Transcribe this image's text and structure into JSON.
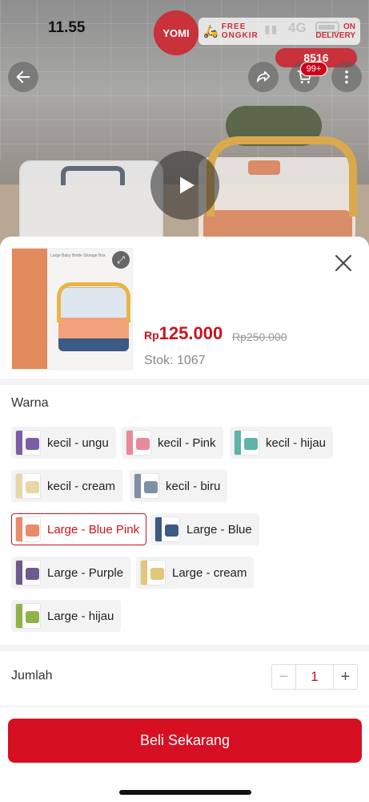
{
  "status_bar": {
    "time": "11.55",
    "network": "4G"
  },
  "header": {
    "brand_logo": "YOMI",
    "promo": {
      "line1": "FREE",
      "line2": "ONGKIR",
      "line3": "ON",
      "line4": "DELIVERY"
    },
    "promo_code": "8516",
    "cart_badge": "99+",
    "icons": {
      "back": "arrow-left-icon",
      "share": "share-icon",
      "cart": "cart-icon",
      "more": "more-vertical-icon",
      "play": "play-icon"
    }
  },
  "sheet": {
    "product": {
      "thumbnail_title": "Large Baby Bottle Storage Box",
      "price_currency": "Rp",
      "price": "125.000",
      "original_price": "Rp250.000",
      "stock_label": "Stok:",
      "stock_value": "1067"
    },
    "variant_label": "Warna",
    "variants": [
      {
        "label": "kecil - ungu",
        "color": "#7b5ea7",
        "selected": false
      },
      {
        "label": "kecil - Pink",
        "color": "#e98a9a",
        "selected": false
      },
      {
        "label": "kecil - hijau",
        "color": "#5fb3a8",
        "selected": false
      },
      {
        "label": "kecil - cream",
        "color": "#e8d6a8",
        "selected": false
      },
      {
        "label": "kecil - biru",
        "color": "#7f8fa6",
        "selected": false
      },
      {
        "label": "Large - Blue Pink",
        "color": "#e98a6a",
        "selected": true
      },
      {
        "label": "Large - Blue",
        "color": "#3d5a80",
        "selected": false
      },
      {
        "label": "Large - Purple",
        "color": "#6f5a8e",
        "selected": false
      },
      {
        "label": "Large - cream",
        "color": "#e0c77a",
        "selected": false
      },
      {
        "label": "Large - hijau",
        "color": "#8fb34a",
        "selected": false
      }
    ],
    "quantity_label": "Jumlah",
    "quantity": "1",
    "minus": "−",
    "plus": "+",
    "buy_button": "Beli Sekarang"
  },
  "colors": {
    "accent": "#c9131e",
    "button": "#d70f23",
    "chip_bg": "#f3f3f3"
  }
}
